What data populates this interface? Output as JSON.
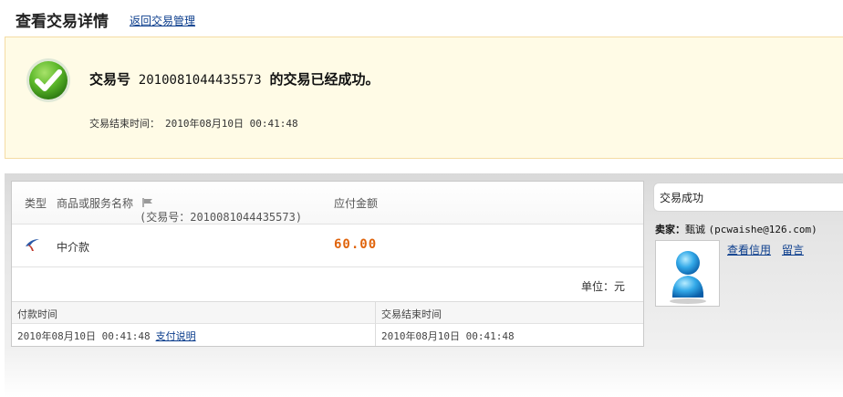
{
  "header": {
    "title": "查看交易详情",
    "back_link": "返回交易管理"
  },
  "success": {
    "prefix": "交易号",
    "trade_no": "2010081044435573",
    "suffix": "的交易已经成功。",
    "end_time_label": "交易结束时间：",
    "end_time_value": "2010年08月10日 00:41:48"
  },
  "order": {
    "columns": {
      "type": "类型",
      "name": "商品或服务名称",
      "trade_no_text": "(交易号：2010081044435573)",
      "amount": "应付金额"
    },
    "item": {
      "name": "中介款",
      "amount": "60.00"
    },
    "unit": "单位：元",
    "time_table": {
      "pay_time_header": "付款时间",
      "end_time_header": "交易结束时间",
      "pay_time_value": "2010年08月10日 00:41:48",
      "pay_link": "支付说明",
      "end_time_value": "2010年08月10日 00:41:48"
    }
  },
  "seller": {
    "status": "交易成功",
    "label": "卖家：",
    "name": "甄诚",
    "email": "(pcwaishe@126.com)",
    "credit_link": "查看信用",
    "message_link": "留言"
  },
  "icons": {
    "check": "check-circle-icon",
    "flag": "flag-icon",
    "type": "escrow-type-icon",
    "avatar": "user-avatar-icon"
  },
  "colors": {
    "amount": "#e0640c",
    "link": "#0a3c8c",
    "success_bg": "#fffbe6",
    "success_border": "#f5dca4"
  }
}
